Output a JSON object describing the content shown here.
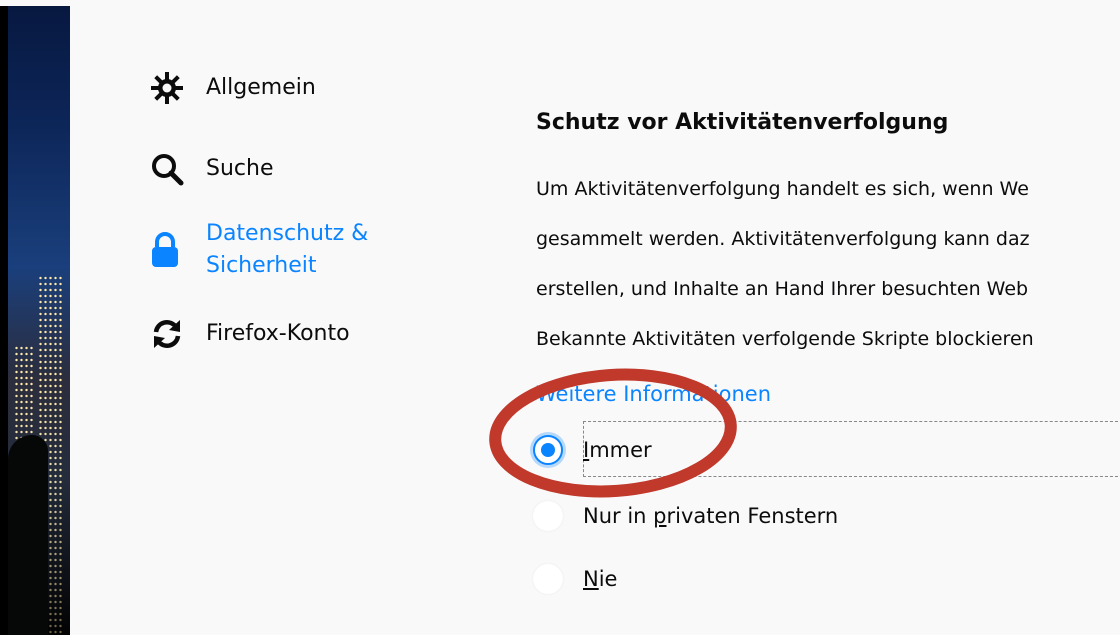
{
  "sidebar": {
    "items": [
      {
        "label": "Allgemein",
        "icon": "gear-icon"
      },
      {
        "label": "Suche",
        "icon": "search-icon"
      },
      {
        "label_line1": "Datenschutz &",
        "label_line2": "Sicherheit",
        "icon": "lock-icon",
        "selected": true
      },
      {
        "label": "Firefox-Konto",
        "icon": "sync-icon"
      }
    ]
  },
  "main": {
    "section_title": "Schutz vor Aktivitätenverfolgung",
    "description_lines": [
      "Um Aktivitätenverfolgung handelt es sich, wenn We",
      "gesammelt werden. Aktivitätenverfolgung kann daz",
      "erstellen, und Inhalte an Hand Ihrer besuchten Web",
      "Bekannte Aktivitäten verfolgende Skripte blockieren"
    ],
    "learn_more": "Weitere Informationen",
    "options": [
      {
        "label": "Immer",
        "underline": "I",
        "rest": "mmer",
        "checked": true
      },
      {
        "label": "Nur in privaten Fenstern",
        "before": "Nur in ",
        "underline": "p",
        "rest": "rivaten Fenstern",
        "checked": false
      },
      {
        "label": "Nie",
        "underline": "N",
        "rest": "ie",
        "checked": false
      }
    ]
  },
  "colors": {
    "accent": "#0a84ff",
    "annotation": "#c0392b",
    "panel_bg": "#f9f9fa",
    "text": "#0c0c0d"
  }
}
